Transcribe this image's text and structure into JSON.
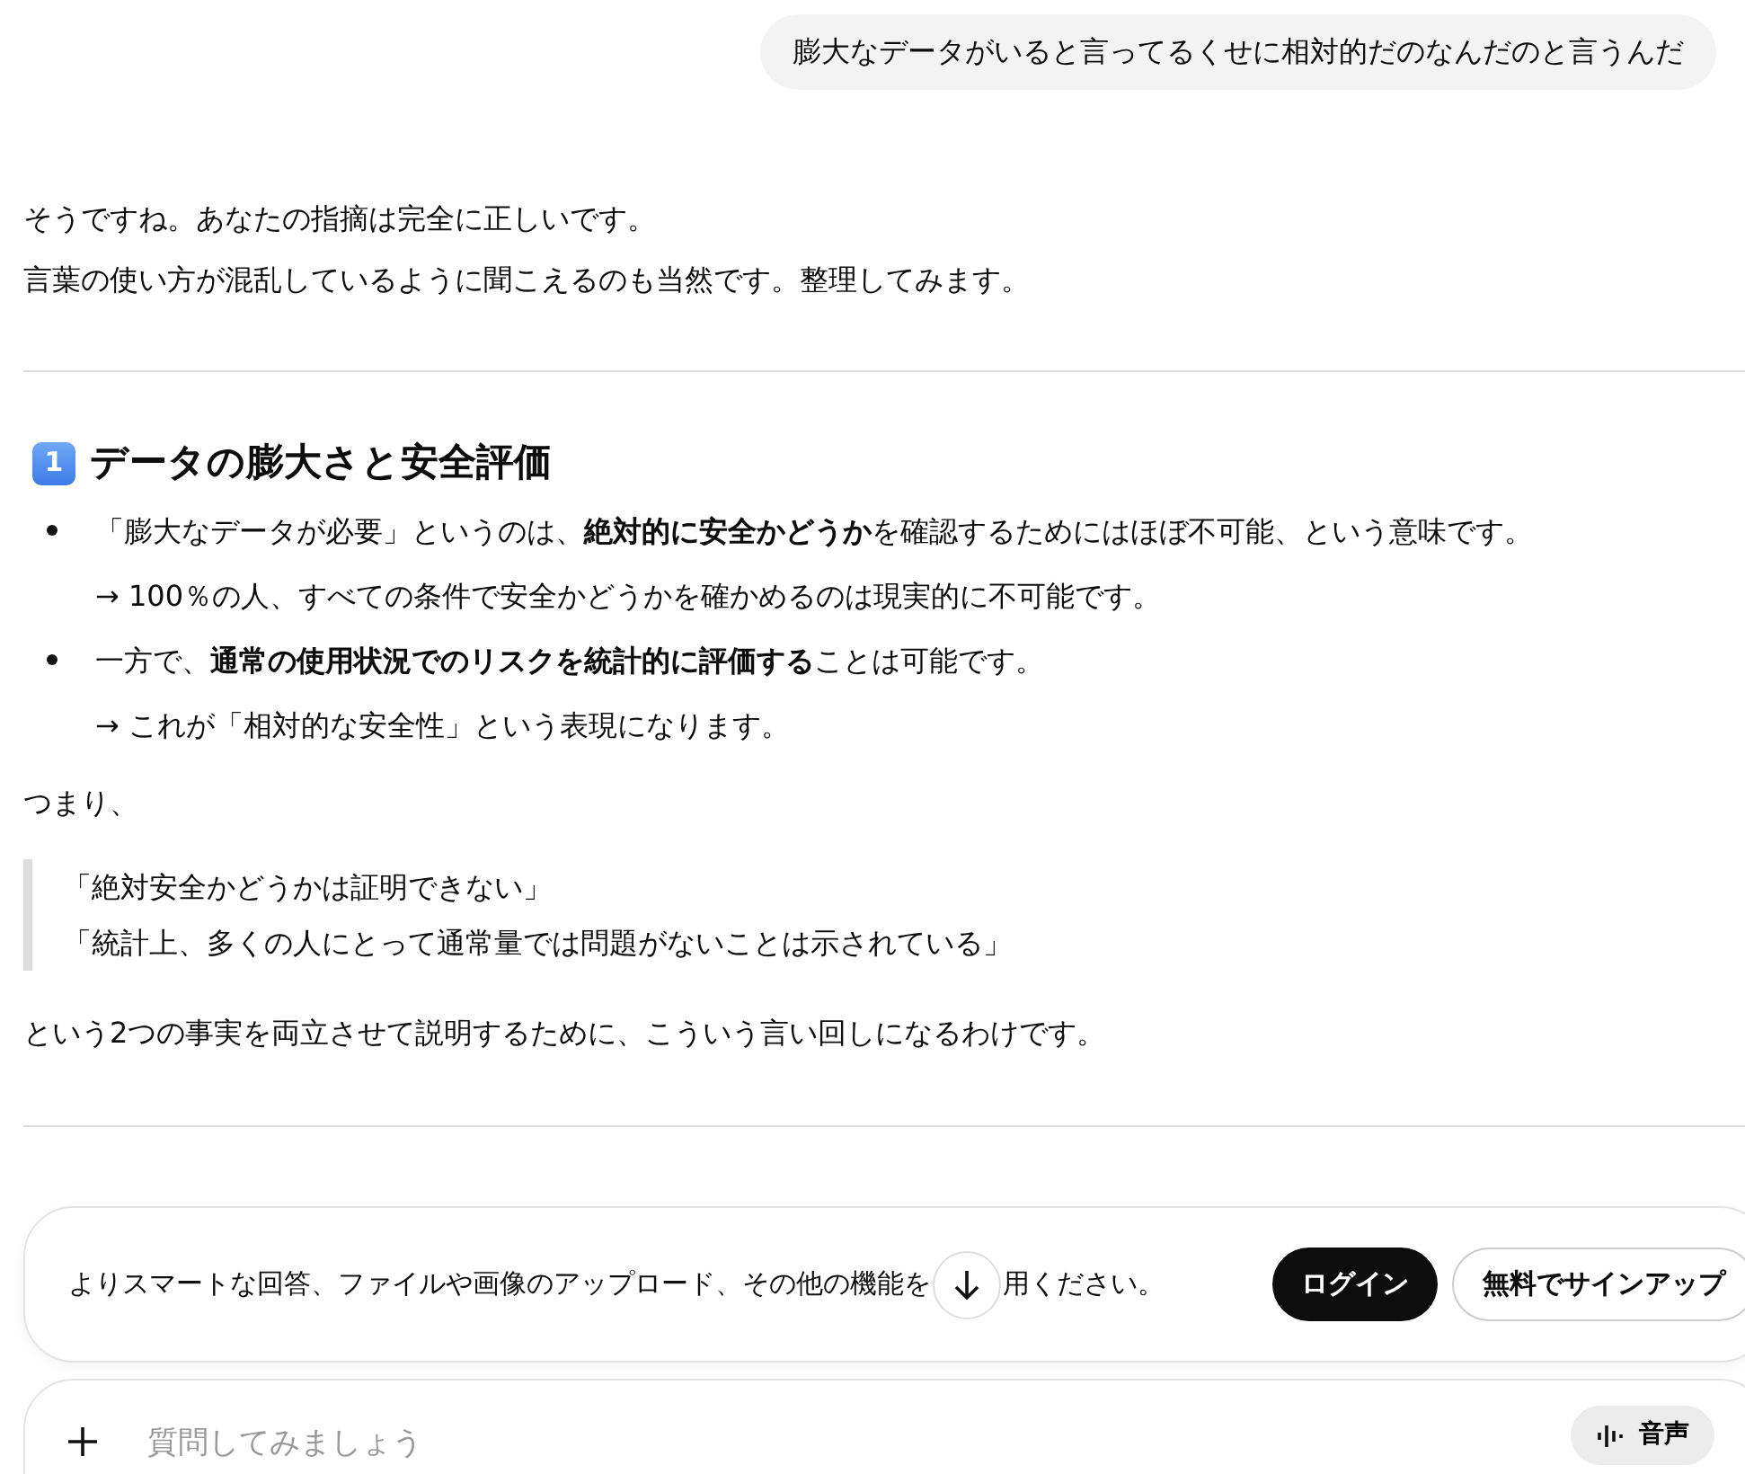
{
  "user_message": "膨大なデータがいると言ってるくせに相対的だのなんだのと言うんだ",
  "intro": [
    "そうですね。あなたの指摘は完全に正しいです。",
    "言葉の使い方が混乱しているように聞こえるのも当然です。整理してみます。"
  ],
  "section": {
    "number": "1",
    "title": "データの膨大さと安全評価",
    "bullets": [
      {
        "text": "「膨大なデータが必要」というのは、**絶対的に安全かどうか**を確認するためにはほぼ不可能、という意味です。",
        "note": "→ 100％の人、すべての条件で安全かどうかを確かめるのは現実的に不可能です。"
      },
      {
        "text": "一方で、**通常の使用状況でのリスクを統計的に評価する**ことは可能です。",
        "note": "→ これが「相対的な安全性」という表現になります。"
      }
    ]
  },
  "lead": "つまり、",
  "quote": [
    "「絶対安全かどうかは証明できない」",
    "「統計上、多くの人にとって通常量では問題がないことは示されている」"
  ],
  "conclusion": "という2つの事実を両立させて説明するために、こういう言い回しになるわけです。",
  "banner": {
    "text_before": "よりスマートな回答、ファイルや画像のアップロード、その他の機能を",
    "text_after": "用ください。",
    "buttons": [
      {
        "label": "ログイン",
        "kind": "primary"
      },
      {
        "label": "無料でサインアップ",
        "kind": "outline"
      }
    ]
  },
  "composer": {
    "placeholder": "質問してみましょう",
    "voice_label": "音声"
  }
}
